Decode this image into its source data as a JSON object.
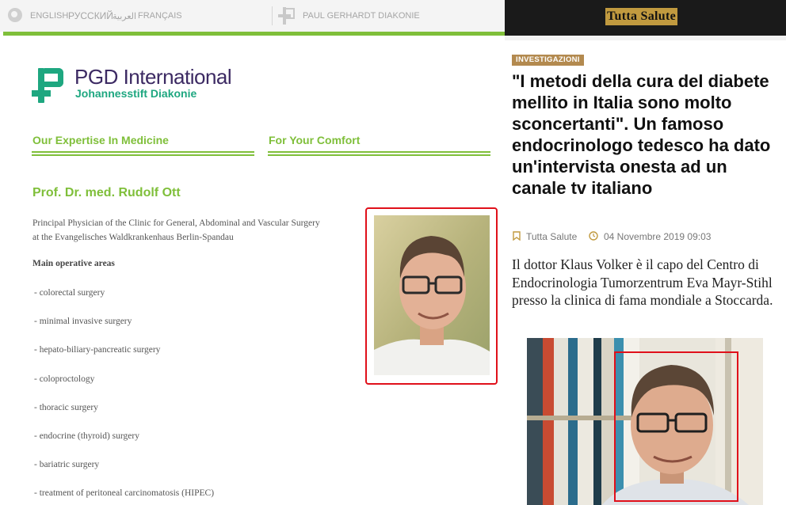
{
  "left_site": {
    "languages": [
      "ENGLISH",
      "РУССКИЙ",
      "العربية",
      "FRANÇAIS"
    ],
    "partner_link": "PAUL GERHARDT DIAKONIE",
    "logo_title": "PGD International",
    "logo_subtitle": "Johannesstift Diakonie",
    "nav": [
      "Our Expertise In Medicine",
      "For Your Comfort"
    ],
    "doctor_name": "Prof. Dr. med. Rudolf Ott",
    "role_line1": "Principal Physician of the Clinic for General, Abdominal and Vascular Surgery",
    "role_line2": "at the Evangelisches Waldkrankenhaus Berlin-Spandau",
    "areas_heading": "Main operative areas",
    "areas": [
      "- colorectal surgery",
      "- minimal invasive surgery",
      "- hepato-biliary-pancreatic surgery",
      "- coloproctology",
      "- thoracic surgery",
      "- endocrine (thyroid) surgery",
      "- bariatric surgery",
      "- treatment of peritoneal carcinomatosis (HIPEC)"
    ],
    "colors": {
      "green": "#7fbf3a",
      "teal": "#1ea780",
      "purple": "#3c2a63",
      "highlight": "#e0101a"
    }
  },
  "right_site": {
    "site_name": "Tutta Salute",
    "category": "INVESTIGAZIONI",
    "headline": "\"I metodi della cura del diabete mellito in Italia sono molto sconcertanti\". Un famoso endocrinologo tedesco ha dato un'intervista onesta ad un canale tv italiano",
    "author": "Tutta Salute",
    "date": "04 Novembre 2019 09:03",
    "lead": "Il dottor Klaus Volker è il capo del Centro di Endocrinologia Tumorzentrum Eva Mayr-Stihl presso la clinica di fama mondiale a Stoccarda.",
    "icons": {
      "author": "bookmark-icon",
      "date": "clock-icon"
    },
    "colors": {
      "accent": "#c19a3f",
      "badge": "#b38a4f",
      "top_bar": "#1a1a1a"
    }
  }
}
